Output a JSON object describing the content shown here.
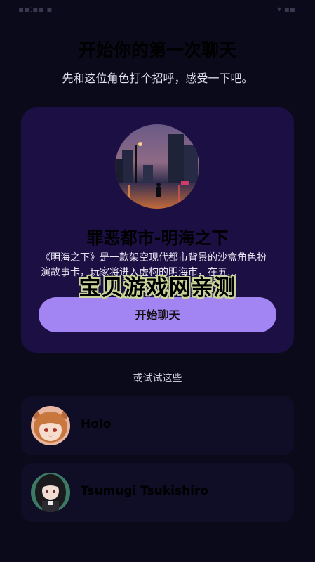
{
  "header": {
    "title": "开始你的第一次聊天",
    "subtitle": "先和这位角色打个招呼，感受一下吧。"
  },
  "featured": {
    "title": "罪恶都市-明海之下",
    "description": "《明海之下》是一款架空现代都市背景的沙盒角色扮演故事卡，玩家将进入虚构的明海市，在五…",
    "start_button": "开始聊天",
    "avatar_icon": "night-city-avatar"
  },
  "watermark": "宝贝游戏网亲测",
  "suggestions": {
    "label": "或试试这些",
    "items": [
      {
        "name": "Holo",
        "avatar_icon": "holo-avatar"
      },
      {
        "name": "Tsumugi Tsukishiro",
        "avatar_icon": "tsumugi-avatar"
      }
    ]
  },
  "colors": {
    "background": "#0b0a1a",
    "card": "#1b0f44",
    "accent": "#a384f3",
    "row": "#100e27"
  }
}
